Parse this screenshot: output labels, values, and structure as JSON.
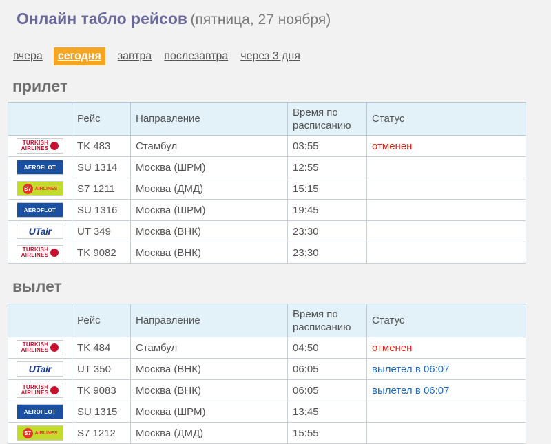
{
  "header": {
    "title": "Онлайн табло рейсов",
    "subtitle": "(пятница, 27 ноября)"
  },
  "days": [
    {
      "label": "вчера",
      "active": false
    },
    {
      "label": "сегодня",
      "active": true
    },
    {
      "label": "завтра",
      "active": false
    },
    {
      "label": "послезавтра",
      "active": false
    },
    {
      "label": "через 3 дня",
      "active": false
    }
  ],
  "columns": {
    "flight": "Рейс",
    "direction": "Направление",
    "time": "Время по расписанию",
    "status": "Статус"
  },
  "airlines": {
    "TK": {
      "line1": "TURKISH",
      "line2": "AIRLINES",
      "icon": "turkish-airlines-logo-icon",
      "color": "#c8102e"
    },
    "SU": {
      "text": "AEROFLOT",
      "icon": "aeroflot-logo-icon",
      "color": "#1b4fa0"
    },
    "S7": {
      "badge": "S7",
      "text": "AIRLINES",
      "icon": "s7-airlines-logo-icon",
      "color": "#c3dc2c"
    },
    "UT": {
      "text": "UTair",
      "icon": "utair-logo-icon",
      "color": "#1d3f8f"
    }
  },
  "arrivals": {
    "title": "прилет",
    "rows": [
      {
        "airline": "TK",
        "flight": "TK 483",
        "direction": "Стамбул",
        "time": "03:55",
        "status": "отменен",
        "status_type": "cancelled"
      },
      {
        "airline": "SU",
        "flight": "SU 1314",
        "direction": "Москва (ШРМ)",
        "time": "12:55",
        "status": "",
        "status_type": ""
      },
      {
        "airline": "S7",
        "flight": "S7 1211",
        "direction": "Москва (ДМД)",
        "time": "15:15",
        "status": "",
        "status_type": ""
      },
      {
        "airline": "SU",
        "flight": "SU 1316",
        "direction": "Москва (ШРМ)",
        "time": "19:45",
        "status": "",
        "status_type": ""
      },
      {
        "airline": "UT",
        "flight": "UT 349",
        "direction": "Москва (ВНК)",
        "time": "23:30",
        "status": "",
        "status_type": ""
      },
      {
        "airline": "TK",
        "flight": "TK 9082",
        "direction": "Москва (ВНК)",
        "time": "23:30",
        "status": "",
        "status_type": ""
      }
    ]
  },
  "departures": {
    "title": "вылет",
    "rows": [
      {
        "airline": "TK",
        "flight": "TK 484",
        "direction": "Стамбул",
        "time": "04:50",
        "status": "отменен",
        "status_type": "cancelled"
      },
      {
        "airline": "UT",
        "flight": "UT 350",
        "direction": "Москва (ВНК)",
        "time": "06:05",
        "status": "вылетел в 06:07",
        "status_type": "departed"
      },
      {
        "airline": "TK",
        "flight": "TK 9083",
        "direction": "Москва (ВНК)",
        "time": "06:05",
        "status": "вылетел в 06:07",
        "status_type": "departed"
      },
      {
        "airline": "SU",
        "flight": "SU 1315",
        "direction": "Москва (ШРМ)",
        "time": "13:45",
        "status": "",
        "status_type": ""
      },
      {
        "airline": "S7",
        "flight": "S7 1212",
        "direction": "Москва (ДМД)",
        "time": "15:55",
        "status": "",
        "status_type": ""
      }
    ]
  }
}
